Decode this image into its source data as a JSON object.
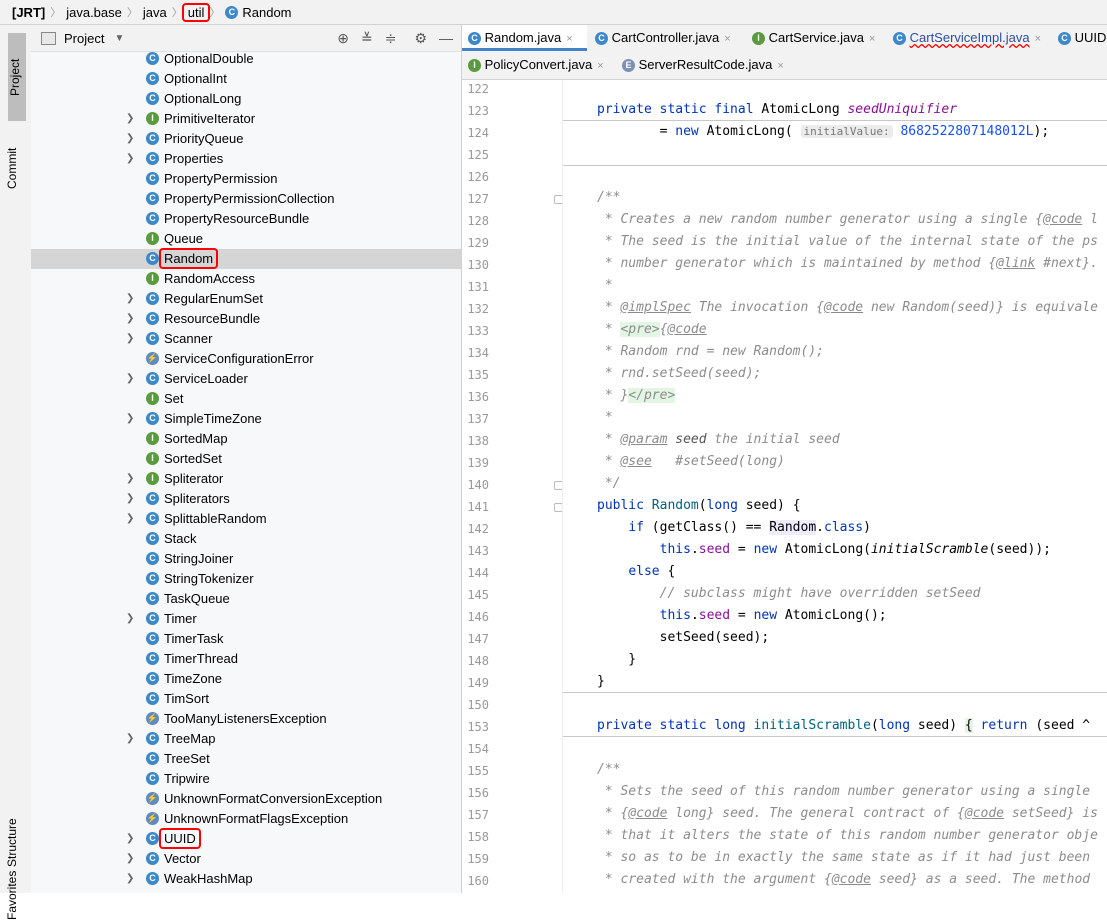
{
  "breadcrumb": [
    "[JRT]",
    "java.base",
    "java",
    "util",
    "Random"
  ],
  "project_panel": {
    "title": "Project",
    "items": [
      {
        "label": "OptionalDouble",
        "icon": "class-icon",
        "expandable": false
      },
      {
        "label": "OptionalInt",
        "icon": "class-icon",
        "expandable": false
      },
      {
        "label": "OptionalLong",
        "icon": "class-icon",
        "expandable": false
      },
      {
        "label": "PrimitiveIterator",
        "icon": "interface-icon",
        "expandable": true
      },
      {
        "label": "PriorityQueue",
        "icon": "class-icon",
        "expandable": true
      },
      {
        "label": "Properties",
        "icon": "class-icon",
        "expandable": true
      },
      {
        "label": "PropertyPermission",
        "icon": "class-icon",
        "expandable": false
      },
      {
        "label": "PropertyPermissionCollection",
        "icon": "class-icon",
        "expandable": false
      },
      {
        "label": "PropertyResourceBundle",
        "icon": "class-icon",
        "expandable": false
      },
      {
        "label": "Queue",
        "icon": "interface-icon",
        "expandable": false
      },
      {
        "label": "Random",
        "icon": "class-icon",
        "expandable": false,
        "selected": true
      },
      {
        "label": "RandomAccess",
        "icon": "interface-icon",
        "expandable": false
      },
      {
        "label": "RegularEnumSet",
        "icon": "class-icon",
        "expandable": true
      },
      {
        "label": "ResourceBundle",
        "icon": "abstract-class-icon",
        "expandable": true
      },
      {
        "label": "Scanner",
        "icon": "class-icon",
        "expandable": true
      },
      {
        "label": "ServiceConfigurationError",
        "icon": "exception-icon",
        "expandable": false
      },
      {
        "label": "ServiceLoader",
        "icon": "class-icon",
        "expandable": true
      },
      {
        "label": "Set",
        "icon": "interface-icon",
        "expandable": false
      },
      {
        "label": "SimpleTimeZone",
        "icon": "class-icon",
        "expandable": true
      },
      {
        "label": "SortedMap",
        "icon": "interface-icon",
        "expandable": false
      },
      {
        "label": "SortedSet",
        "icon": "interface-icon",
        "expandable": false
      },
      {
        "label": "Spliterator",
        "icon": "interface-icon",
        "expandable": true
      },
      {
        "label": "Spliterators",
        "icon": "class-icon",
        "expandable": true
      },
      {
        "label": "SplittableRandom",
        "icon": "class-icon",
        "expandable": true
      },
      {
        "label": "Stack",
        "icon": "class-icon",
        "expandable": false
      },
      {
        "label": "StringJoiner",
        "icon": "class-icon",
        "expandable": false
      },
      {
        "label": "StringTokenizer",
        "icon": "class-icon",
        "expandable": false
      },
      {
        "label": "TaskQueue",
        "icon": "class-icon",
        "expandable": false
      },
      {
        "label": "Timer",
        "icon": "class-icon",
        "expandable": true
      },
      {
        "label": "TimerTask",
        "icon": "abstract-class-icon",
        "expandable": false
      },
      {
        "label": "TimerThread",
        "icon": "class-icon",
        "expandable": false
      },
      {
        "label": "TimeZone",
        "icon": "abstract-class-icon",
        "expandable": false
      },
      {
        "label": "TimSort",
        "icon": "class-icon",
        "expandable": false
      },
      {
        "label": "TooManyListenersException",
        "icon": "exception-icon",
        "expandable": false
      },
      {
        "label": "TreeMap",
        "icon": "class-icon",
        "expandable": true
      },
      {
        "label": "TreeSet",
        "icon": "class-icon",
        "expandable": false
      },
      {
        "label": "Tripwire",
        "icon": "class-icon",
        "expandable": false
      },
      {
        "label": "UnknownFormatConversionException",
        "icon": "exception-icon",
        "expandable": false
      },
      {
        "label": "UnknownFormatFlagsException",
        "icon": "exception-icon",
        "expandable": false
      },
      {
        "label": "UUID",
        "icon": "class-icon",
        "expandable": true
      },
      {
        "label": "Vector",
        "icon": "class-icon",
        "expandable": true
      },
      {
        "label": "WeakHashMap",
        "icon": "class-icon",
        "expandable": true
      }
    ]
  },
  "side_tabs": {
    "project": "Project",
    "commit": "Commit",
    "structure": "Structure",
    "favorites": "Favorites"
  },
  "tabs_row1": [
    "Random.java",
    "CartController.java",
    "CartService.java",
    "CartServiceImpl.java",
    "UUID"
  ],
  "tabs_row2": [
    "PolicyConvert.java",
    "ServerResultCode.java"
  ],
  "editor": {
    "line_numbers": [
      "122",
      "123",
      "124",
      "125",
      "126",
      "127",
      "128",
      "129",
      "130",
      "131",
      "132",
      "133",
      "134",
      "135",
      "136",
      "137",
      "138",
      "139",
      "140",
      "141",
      "142",
      "143",
      "144",
      "145",
      "146",
      "147",
      "148",
      "149",
      "150",
      "153",
      "154",
      "155",
      "156",
      "157",
      "158",
      "159",
      "160"
    ],
    "inlay_hint": "initialValue:"
  },
  "colors": {
    "keyword": "#0033b3",
    "comment": "#8c8c8c",
    "field": "#871094",
    "number": "#1750eb",
    "highlight": "#ff0000"
  }
}
